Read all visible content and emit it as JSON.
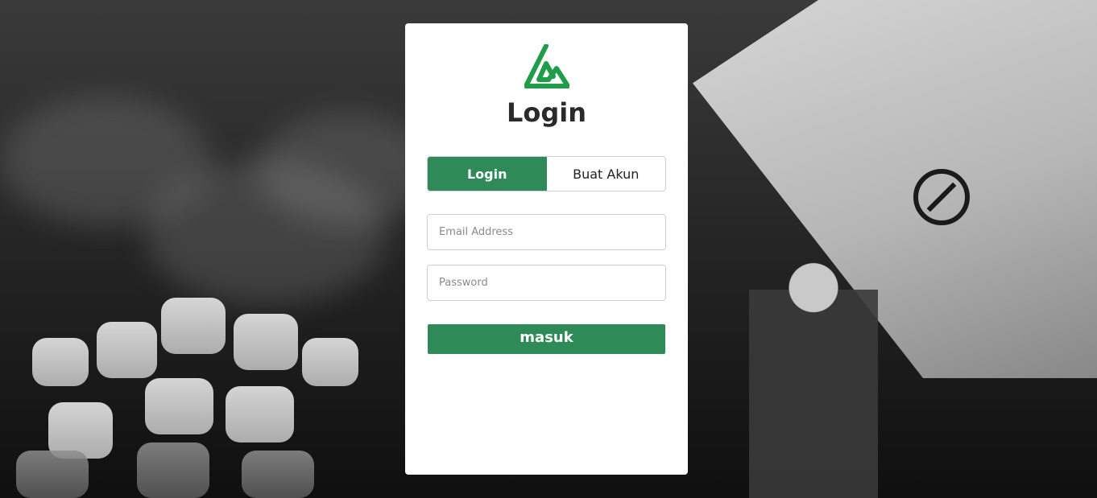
{
  "login_card": {
    "title": "Login",
    "logo": "green-triangle-logo-icon"
  },
  "tabs": [
    {
      "label": "Login",
      "active": true
    },
    {
      "label": "Buat Akun",
      "active": false
    }
  ],
  "form": {
    "email_placeholder": "Email Address",
    "email_value": "",
    "password_placeholder": "Password",
    "password_value": "",
    "submit_label": "masuk"
  },
  "colors": {
    "accent": "#2e8b57",
    "card_bg": "#ffffff"
  }
}
